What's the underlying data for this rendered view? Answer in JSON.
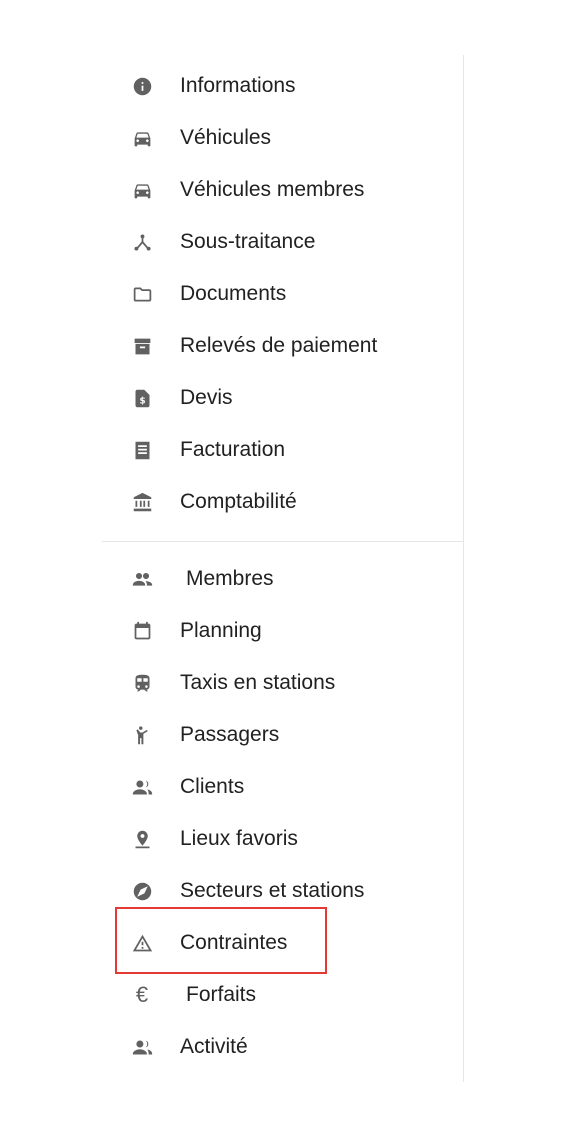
{
  "sidebar": {
    "group1": [
      {
        "label": "Informations",
        "icon": "info-icon"
      },
      {
        "label": "Véhicules",
        "icon": "car-icon"
      },
      {
        "label": "Véhicules membres",
        "icon": "car-icon"
      },
      {
        "label": "Sous-traitance",
        "icon": "hub-icon"
      },
      {
        "label": "Documents",
        "icon": "folder-icon"
      },
      {
        "label": "Relevés de paiement",
        "icon": "archive-icon"
      },
      {
        "label": "Devis",
        "icon": "dollar-file-icon"
      },
      {
        "label": "Facturation",
        "icon": "receipt-icon"
      },
      {
        "label": "Comptabilité",
        "icon": "bank-icon"
      }
    ],
    "group2": [
      {
        "label": "Membres",
        "icon": "people-icon"
      },
      {
        "label": "Planning",
        "icon": "calendar-icon"
      },
      {
        "label": "Taxis en stations",
        "icon": "bus-icon"
      },
      {
        "label": "Passagers",
        "icon": "walking-person-icon"
      },
      {
        "label": "Clients",
        "icon": "group-icon"
      },
      {
        "label": "Lieux favoris",
        "icon": "pin-icon"
      },
      {
        "label": "Secteurs et stations",
        "icon": "compass-icon"
      },
      {
        "label": "Contraintes",
        "icon": "warning-icon"
      },
      {
        "label": "Forfaits",
        "icon": "euro-icon",
        "glyph": "€"
      },
      {
        "label": "Activité",
        "icon": "group-icon"
      }
    ]
  },
  "highlight_color": "#e53935"
}
